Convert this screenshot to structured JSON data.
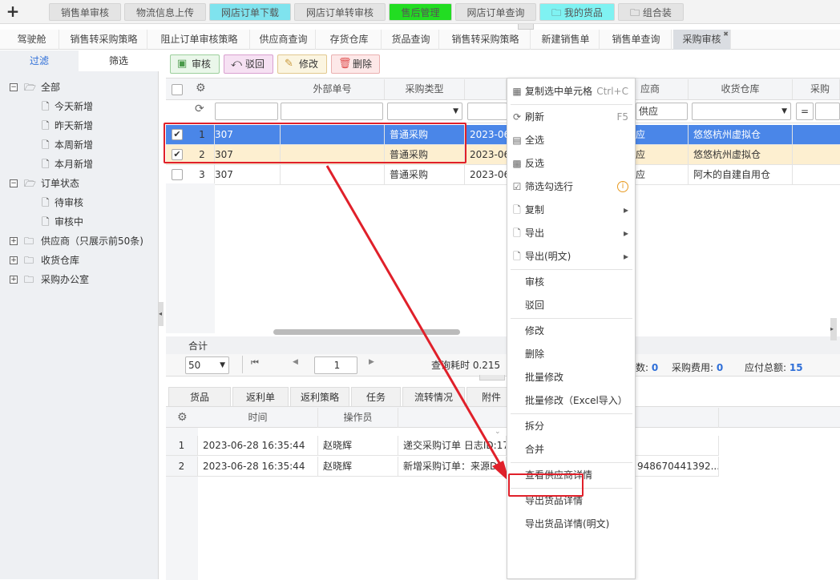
{
  "topbar": {
    "plus": "+",
    "tabs": [
      {
        "label": "销售单审核",
        "bg": "#e2e2e2"
      },
      {
        "label": "物流信息上传",
        "bg": "#e2e2e2"
      },
      {
        "label": "网店订单下载",
        "bg": "#7fe3ee"
      },
      {
        "label": "网店订单转审核",
        "bg": "#e2e2e2"
      },
      {
        "label": "售后管理",
        "bg": "#22dd22"
      },
      {
        "label": "网店订单查询",
        "bg": "#e2e2e2"
      },
      {
        "label": "我的货品",
        "bg": "#7ff2f2"
      },
      {
        "label": "组合装",
        "bg": "#e2e2e2"
      }
    ]
  },
  "tabs2": [
    "驾驶舱",
    "销售转采购策略",
    "阻止订单审核策略",
    "供应商查询",
    "存货仓库",
    "货品查询",
    "销售转采购策略",
    "新建销售单",
    "销售单查询",
    "采购审核"
  ],
  "tabs2_close": "✖",
  "left": {
    "tab_filter": "过滤",
    "tab_select": "筛选",
    "tree": [
      {
        "label": "全部",
        "toggle": "−",
        "type": "folder-open"
      },
      {
        "label": "今天新增",
        "type": "file"
      },
      {
        "label": "昨天新增",
        "type": "file"
      },
      {
        "label": "本周新增",
        "type": "file"
      },
      {
        "label": "本月新增",
        "type": "file"
      },
      {
        "label": "订单状态",
        "toggle": "−",
        "type": "folder-open"
      },
      {
        "label": "待审核",
        "type": "file"
      },
      {
        "label": "审核中",
        "type": "file"
      },
      {
        "label": "供应商（只展示前50条)",
        "toggle": "+",
        "type": "folder"
      },
      {
        "label": "收货仓库",
        "toggle": "+",
        "type": "folder"
      },
      {
        "label": "采购办公室",
        "toggle": "+",
        "type": "folder"
      }
    ]
  },
  "toolbar": {
    "approve": "审核",
    "reject": "驳回",
    "edit": "修改",
    "delete": "删除"
  },
  "grid": {
    "headers": {
      "external_no": "外部单号",
      "purchase_type": "采购类型",
      "supplier": "应商",
      "warehouse": "收货仓库",
      "cut": "采购"
    },
    "filters": {
      "supplier": "供应",
      "cut_op": "="
    },
    "rows": [
      {
        "num": "1",
        "code": "307",
        "type": "普通采购",
        "date": "2023-06",
        "supplier": "应",
        "warehouse": "悠悠杭州虚拟仓",
        "checked": true
      },
      {
        "num": "2",
        "code": "307",
        "type": "普通采购",
        "date": "2023-06",
        "supplier": "应",
        "warehouse": "悠悠杭州虚拟仓",
        "checked": true
      },
      {
        "num": "3",
        "code": "307",
        "type": "普通采购",
        "date": "2023-06",
        "supplier": "应",
        "warehouse": "阿木的自建自用仓",
        "checked": false
      }
    ],
    "check_mark": "✔",
    "total_label": "合计",
    "page_size": "50",
    "page_num": "1",
    "query_time": "查询耗时 0.215",
    "summary": [
      {
        "label": "数:",
        "value": "0"
      },
      {
        "label": "采购费用:",
        "value": "0"
      },
      {
        "label": "应付总额:",
        "value": "15"
      }
    ]
  },
  "context_menu": [
    {
      "label": "复制选中单元格",
      "key": "Ctrl+C",
      "icon": "grid-icon"
    },
    {
      "sep": true
    },
    {
      "label": "刷新",
      "key": "F5",
      "icon": "refresh-icon"
    },
    {
      "label": "全选",
      "icon": "select-all-icon"
    },
    {
      "label": "反选",
      "icon": "invert-select-icon"
    },
    {
      "label": "筛选勾选行",
      "icon": "check-filter-icon",
      "info": "i"
    },
    {
      "label": "复制",
      "icon": "copy-icon",
      "arrow": "▸"
    },
    {
      "label": "导出",
      "icon": "export-icon",
      "arrow": "▸"
    },
    {
      "label": "导出(明文)",
      "icon": "export-plain-icon",
      "arrow": "▸"
    },
    {
      "sep": true
    },
    {
      "label": "审核"
    },
    {
      "label": "驳回"
    },
    {
      "sep": true
    },
    {
      "label": "修改"
    },
    {
      "label": "删除"
    },
    {
      "label": "批量修改"
    },
    {
      "label": "批量修改（Excel导入）"
    },
    {
      "sep": true
    },
    {
      "label": "拆分"
    },
    {
      "label": "合并"
    },
    {
      "sep": true
    },
    {
      "label": "查看供应商详情"
    },
    {
      "sep": true
    },
    {
      "label": "导出货品详情"
    },
    {
      "label": "导出货品详情(明文)"
    }
  ],
  "bottom": {
    "tabs": [
      "货品",
      "返利单",
      "返利策略",
      "任务",
      "流转情况",
      "附件"
    ],
    "headers": {
      "time": "时间",
      "operator": "操作员"
    },
    "logs": [
      {
        "num": "1",
        "time": "2023-06-28 16:35:44",
        "operator": "赵晓辉",
        "content": "递交采购订单 日志ID:17",
        "extra": ""
      },
      {
        "num": "2",
        "time": "2023-06-28 16:35:44",
        "operator": "赵晓辉",
        "content": "新增采购订单：来源Dy",
        "extra": "948670441392..."
      }
    ]
  },
  "colors": {
    "accent": "#2f6fd8",
    "highlight": "#e0202a",
    "selected_row": "#4a86e8",
    "second_row": "#fdefd0"
  }
}
